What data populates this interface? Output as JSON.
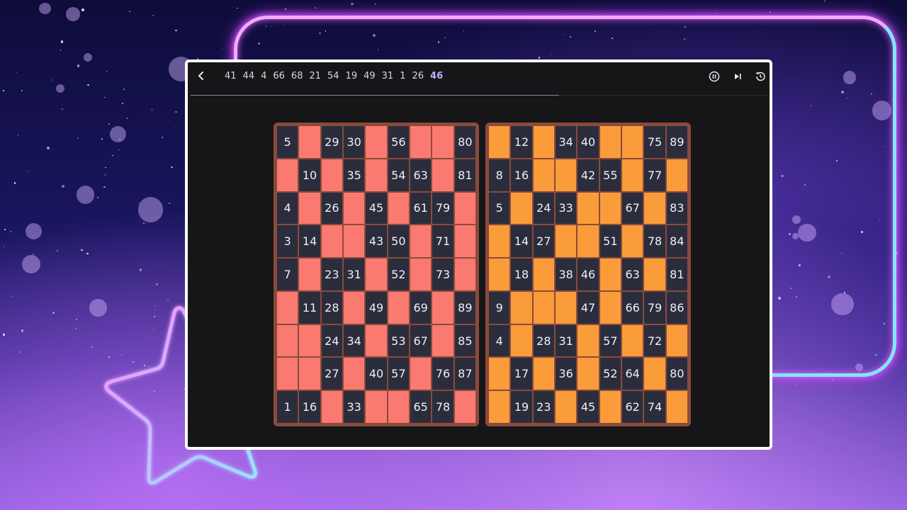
{
  "toolbar": {
    "called_numbers": [
      "41",
      "44",
      "4",
      "66",
      "68",
      "21",
      "54",
      "19",
      "49",
      "31",
      "1",
      "26"
    ],
    "current_number": "46",
    "icons": [
      "chevron-left-icon",
      "pause-icon",
      "skip-next-icon",
      "history-icon"
    ],
    "progress_fraction": 0.64
  },
  "colors": {
    "red_card_mark": "#fa7a72",
    "orange_card_mark": "#fb9c3b",
    "card_border": "#8a4b3b",
    "empty_cell": "#2b2d3d"
  },
  "cards": [
    {
      "name": "red",
      "rows": [
        [
          "5",
          "",
          "29",
          "30",
          "",
          "56",
          "",
          "",
          "80"
        ],
        [
          "",
          "10",
          "",
          "35",
          "",
          "54",
          "63",
          "",
          "81"
        ],
        [
          "4",
          "",
          "26",
          "",
          "45",
          "",
          "61",
          "79",
          ""
        ],
        [
          "3",
          "14",
          "",
          "",
          "43",
          "50",
          "",
          "71",
          ""
        ],
        [
          "7",
          "",
          "23",
          "31",
          "",
          "52",
          "",
          "73",
          ""
        ],
        [
          "",
          "11",
          "28",
          "",
          "49",
          "",
          "69",
          "",
          "89"
        ],
        [
          "",
          "",
          "24",
          "34",
          "",
          "53",
          "67",
          "",
          "85"
        ],
        [
          "",
          "",
          "27",
          "",
          "40",
          "57",
          "",
          "76",
          "87"
        ],
        [
          "1",
          "16",
          "",
          "33",
          "",
          "",
          "65",
          "78",
          ""
        ]
      ]
    },
    {
      "name": "orange",
      "rows": [
        [
          "",
          "12",
          "",
          "34",
          "40",
          "",
          "",
          "75",
          "89"
        ],
        [
          "8",
          "16",
          "",
          "",
          "42",
          "55",
          "",
          "77",
          ""
        ],
        [
          "5",
          "",
          "24",
          "33",
          "",
          "",
          "67",
          "",
          "83"
        ],
        [
          "",
          "14",
          "27",
          "",
          "",
          "51",
          "",
          "78",
          "84"
        ],
        [
          "",
          "18",
          "",
          "38",
          "46",
          "",
          "63",
          "",
          "81"
        ],
        [
          "9",
          "",
          "",
          "",
          "47",
          "",
          "66",
          "79",
          "86"
        ],
        [
          "4",
          "",
          "28",
          "31",
          "",
          "57",
          "",
          "72",
          ""
        ],
        [
          "",
          "17",
          "",
          "36",
          "",
          "52",
          "64",
          "",
          "80"
        ],
        [
          "",
          "19",
          "23",
          "",
          "45",
          "",
          "62",
          "74",
          ""
        ]
      ]
    }
  ]
}
